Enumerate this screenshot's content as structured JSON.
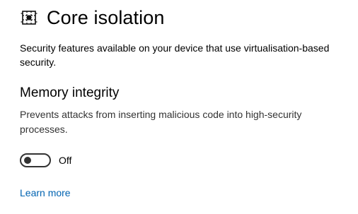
{
  "header": {
    "icon": "core-isolation-chip-icon",
    "title": "Core isolation"
  },
  "description": "Security features available on your device that use virtualisation-based security.",
  "memory_integrity": {
    "title": "Memory integrity",
    "description": "Prevents attacks from inserting malicious code into high-security processes.",
    "toggle": {
      "state": "off",
      "label": "Off"
    }
  },
  "learn_more": {
    "label": "Learn more",
    "color": "#0063b1"
  }
}
